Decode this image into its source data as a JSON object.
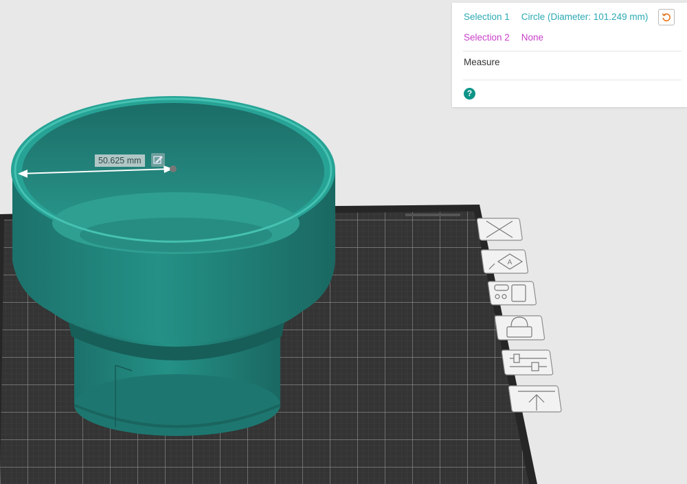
{
  "measure_panel": {
    "selection1_key": "Selection 1",
    "selection1_value": "Circle (Diameter: 101.249 mm)",
    "selection2_key": "Selection 2",
    "selection2_value": "None",
    "title": "Measure",
    "help_icon": "?",
    "reset_icon": "reset-icon"
  },
  "viewport": {
    "dimension_label": "50.625 mm",
    "edit_icon": "pencil-icon",
    "model_color": "#1f7d76",
    "plate_color": "#2e2e2e"
  },
  "view_tools": [
    {
      "name": "fit-view-icon"
    },
    {
      "name": "auto-orient-icon"
    },
    {
      "name": "arrange-icon"
    },
    {
      "name": "lock-icon"
    },
    {
      "name": "layout-settings-icon"
    },
    {
      "name": "lay-flat-icon"
    }
  ],
  "colors": {
    "selection1": "#2aa9b3",
    "selection2": "#c93fc9",
    "accent": "#0e9488"
  }
}
